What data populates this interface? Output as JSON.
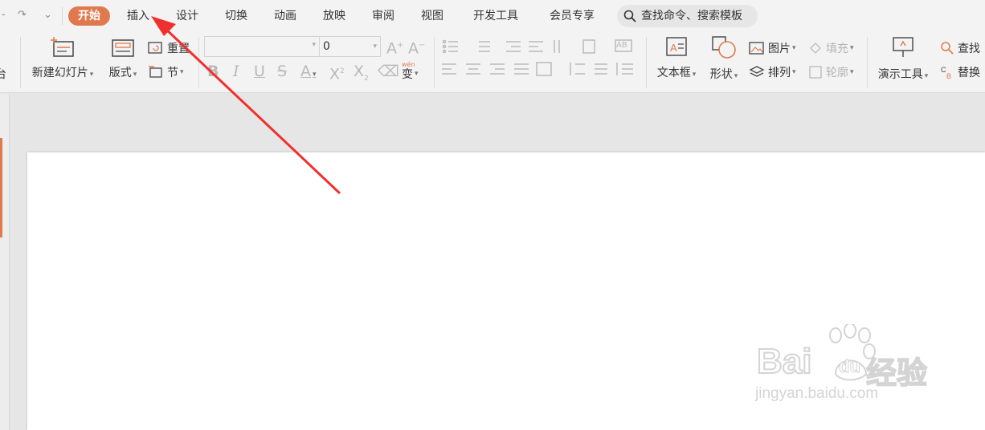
{
  "quick_access": {
    "redo": "↷",
    "customize": "⌄",
    "partial_left": "-"
  },
  "menu": {
    "tabs": [
      "开始",
      "插入",
      "设计",
      "切换",
      "动画",
      "放映",
      "审阅",
      "视图",
      "开发工具",
      "会员专享"
    ],
    "active_index": 0,
    "search_placeholder": "查找命令、搜索模板"
  },
  "ribbon": {
    "cut_partial": "台",
    "new_slide": "新建幻灯片",
    "layout": "版式",
    "reset": "重置",
    "section": "节",
    "font_name": "",
    "font_size": "0",
    "pinyin_top": "wén",
    "pinyin": "变",
    "text_box": "文本框",
    "shapes": "形状",
    "picture": "图片",
    "fill": "填充",
    "arrange": "排列",
    "outline": "轮廓",
    "presenter_tools": "演示工具",
    "find": "查找",
    "replace": "替换",
    "ab": "AB"
  },
  "watermark": {
    "brand": "Bai",
    "brand2": "du",
    "cn": "经验",
    "url": "jingyan.baidu.com"
  },
  "colors": {
    "accent": "#e07a4e",
    "annotation_arrow": "#f0302c"
  }
}
